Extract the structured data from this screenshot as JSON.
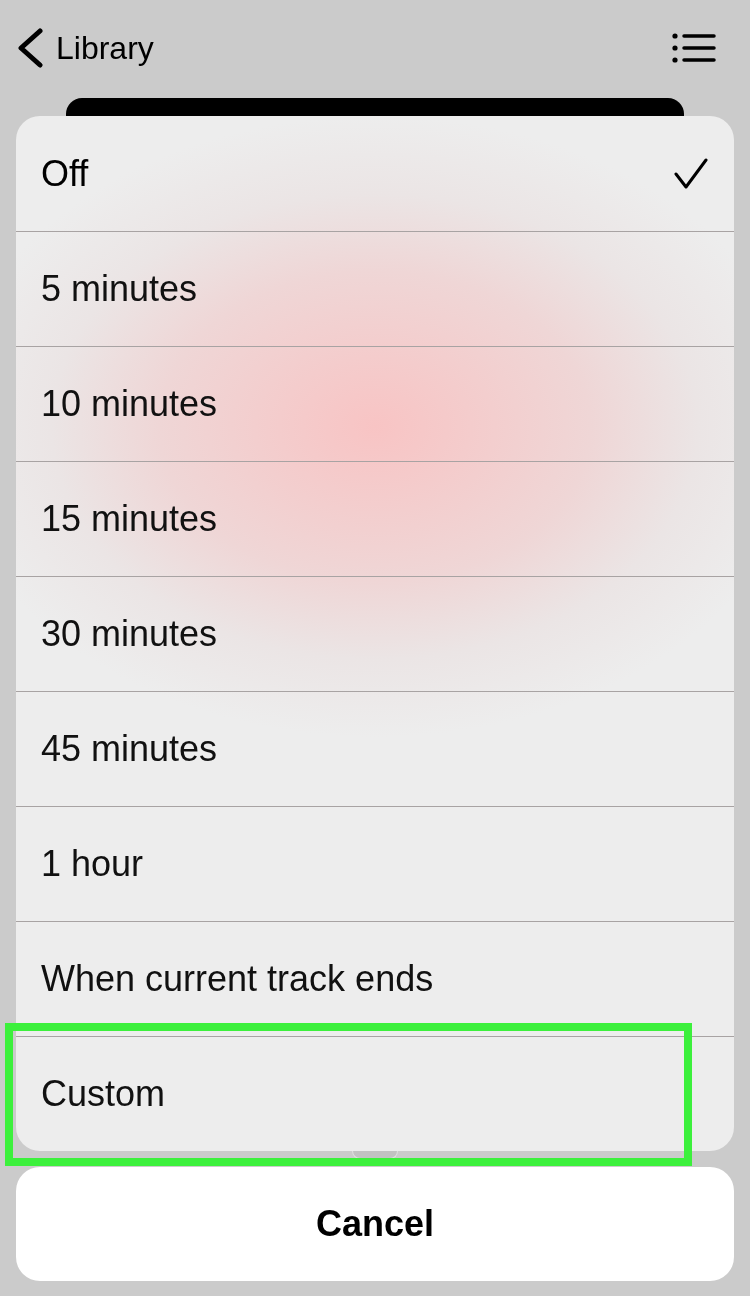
{
  "nav": {
    "back_label": "Library"
  },
  "options": [
    {
      "label": "Off",
      "selected": true,
      "highlighted": false
    },
    {
      "label": "5 minutes",
      "selected": false,
      "highlighted": false
    },
    {
      "label": "10 minutes",
      "selected": false,
      "highlighted": false
    },
    {
      "label": "15 minutes",
      "selected": false,
      "highlighted": false
    },
    {
      "label": "30 minutes",
      "selected": false,
      "highlighted": false
    },
    {
      "label": "45 minutes",
      "selected": false,
      "highlighted": false
    },
    {
      "label": "1 hour",
      "selected": false,
      "highlighted": false
    },
    {
      "label": "When current track ends",
      "selected": false,
      "highlighted": false
    },
    {
      "label": "Custom",
      "selected": false,
      "highlighted": true
    }
  ],
  "cancel": {
    "label": "Cancel"
  }
}
